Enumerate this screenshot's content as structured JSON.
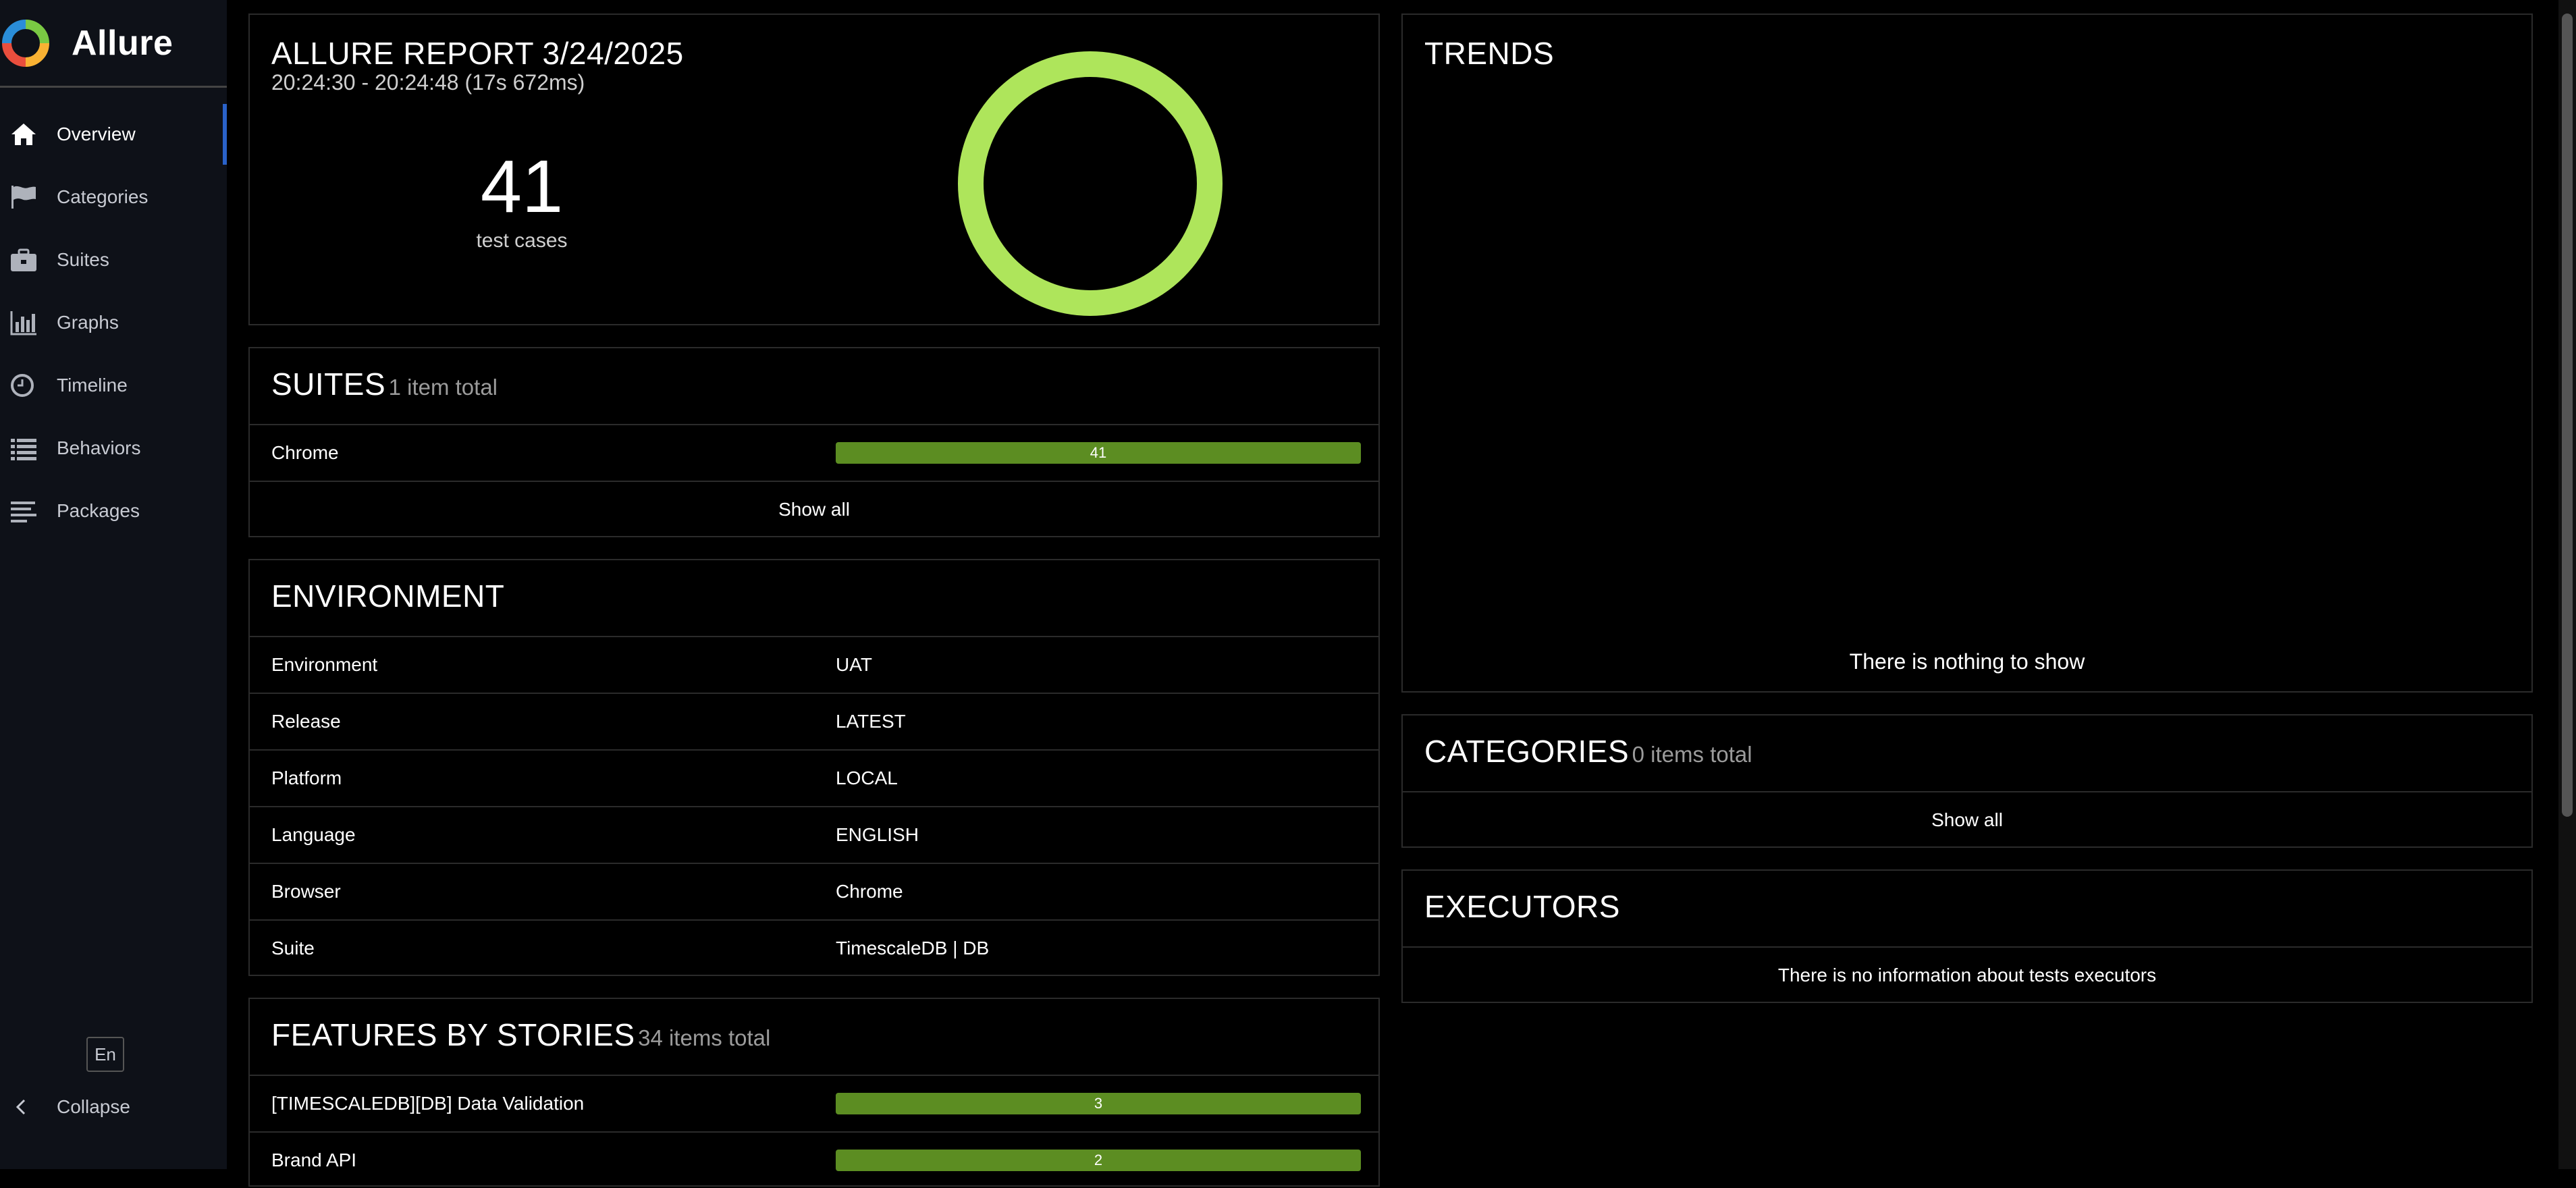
{
  "app": {
    "name": "Allure"
  },
  "sidebar": {
    "items": [
      {
        "label": "Overview",
        "icon": "home-icon"
      },
      {
        "label": "Categories",
        "icon": "flag-icon"
      },
      {
        "label": "Suites",
        "icon": "briefcase-icon"
      },
      {
        "label": "Graphs",
        "icon": "bar-chart-icon"
      },
      {
        "label": "Timeline",
        "icon": "clock-icon"
      },
      {
        "label": "Behaviors",
        "icon": "list-icon"
      },
      {
        "label": "Packages",
        "icon": "align-left-icon"
      }
    ],
    "active": "Overview",
    "language": "En",
    "collapse_label": "Collapse"
  },
  "summary": {
    "title": "ALLURE REPORT 3/24/2025",
    "time_range": "20:24:30 - 20:24:48 (17s 672ms)",
    "test_count": "41",
    "test_count_label": "test cases",
    "donut_color": "#aee55b"
  },
  "suites": {
    "title": "SUITES",
    "count": "1 item total",
    "rows": [
      {
        "name": "Chrome",
        "value": "41"
      }
    ],
    "show_all": "Show all"
  },
  "environment": {
    "title": "ENVIRONMENT",
    "rows": [
      {
        "key": "Environment",
        "value": "UAT"
      },
      {
        "key": "Release",
        "value": "LATEST"
      },
      {
        "key": "Platform",
        "value": "LOCAL"
      },
      {
        "key": "Language",
        "value": "ENGLISH"
      },
      {
        "key": "Browser",
        "value": "Chrome"
      },
      {
        "key": "Suite",
        "value": "TimescaleDB | DB"
      }
    ]
  },
  "features": {
    "title": "FEATURES BY STORIES",
    "count": "34 items total",
    "rows": [
      {
        "name": "[TIMESCALEDB][DB] Data Validation",
        "value": "3"
      },
      {
        "name": "Brand API",
        "value": "2"
      }
    ]
  },
  "trend": {
    "title": "TRENDS",
    "empty": "There is nothing to show"
  },
  "categories": {
    "title": "CATEGORIES",
    "count": "0 items total",
    "show_all": "Show all"
  },
  "executors": {
    "title": "EXECUTORS",
    "empty": "There is no information about tests executors"
  },
  "colors": {
    "passed_bar": "#5c8d22",
    "sidebar_bg": "#0e1118",
    "active_marker": "#2a62c9"
  }
}
